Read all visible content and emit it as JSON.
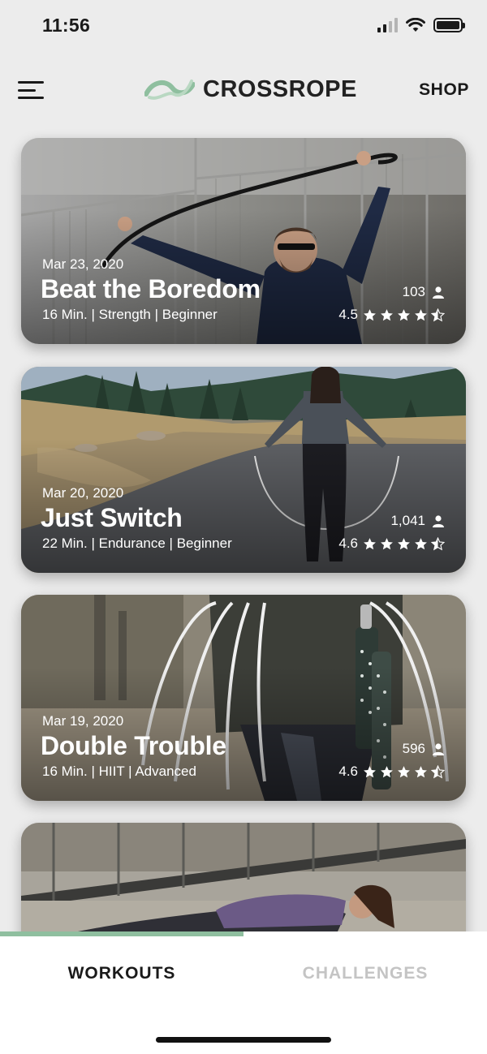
{
  "status_bar": {
    "time": "11:56",
    "icons": [
      "cellular-signal-icon",
      "wifi-icon",
      "battery-icon"
    ]
  },
  "header": {
    "menu_icon": "hamburger-menu-icon",
    "logo_text": "CROSSROPE",
    "shop_label": "SHOP",
    "logo_color": "#8fbf9f"
  },
  "workouts": [
    {
      "date": "Mar 23, 2020",
      "title": "Beat the Boredom",
      "duration": "16 Min.",
      "category": "Strength",
      "level": "Beginner",
      "meta": "16 Min. | Strength | Beginner",
      "users": "103",
      "rating": "4.5",
      "stars": 4.5
    },
    {
      "date": "Mar 20, 2020",
      "title": "Just Switch",
      "duration": "22 Min.",
      "category": "Endurance",
      "level": "Beginner",
      "meta": "22 Min. | Endurance | Beginner",
      "users": "1,041",
      "rating": "4.6",
      "stars": 4.5
    },
    {
      "date": "Mar 19, 2020",
      "title": "Double Trouble",
      "duration": "16 Min.",
      "category": "HIIT",
      "level": "Advanced",
      "meta": "16 Min. | HIIT | Advanced",
      "users": "596",
      "rating": "4.6",
      "stars": 4.5
    }
  ],
  "tabs": [
    {
      "label": "WORKOUTS",
      "active": true
    },
    {
      "label": "CHALLENGES",
      "active": false
    }
  ],
  "colors": {
    "accent": "#8fbf9f",
    "inactive_tab": "#c4c4c4",
    "background": "#ececec"
  }
}
